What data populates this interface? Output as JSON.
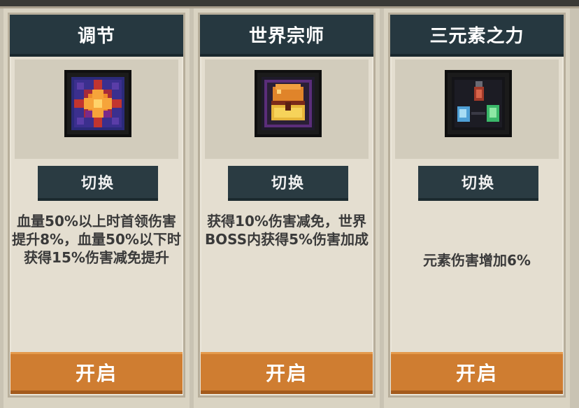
{
  "cards": [
    {
      "title": "调节",
      "icon": "sunburst-icon",
      "switch_label": "切换",
      "description": "血量50%以上时首领伤害提升8%，血量50%以下时获得15%伤害减免提升",
      "open_label": "开启"
    },
    {
      "title": "世界宗师",
      "icon": "treasure-chest-icon",
      "switch_label": "切换",
      "description": "获得10%伤害减免，世界BOSS内获得5%伤害加成",
      "open_label": "开启"
    },
    {
      "title": "三元素之力",
      "icon": "three-elements-icon",
      "switch_label": "切换",
      "description": "元素伤害增加6%",
      "open_label": "开启"
    }
  ],
  "colors": {
    "header_bg": "#263840",
    "open_button": "#cf7d31",
    "switch_button": "#2a3b42"
  }
}
